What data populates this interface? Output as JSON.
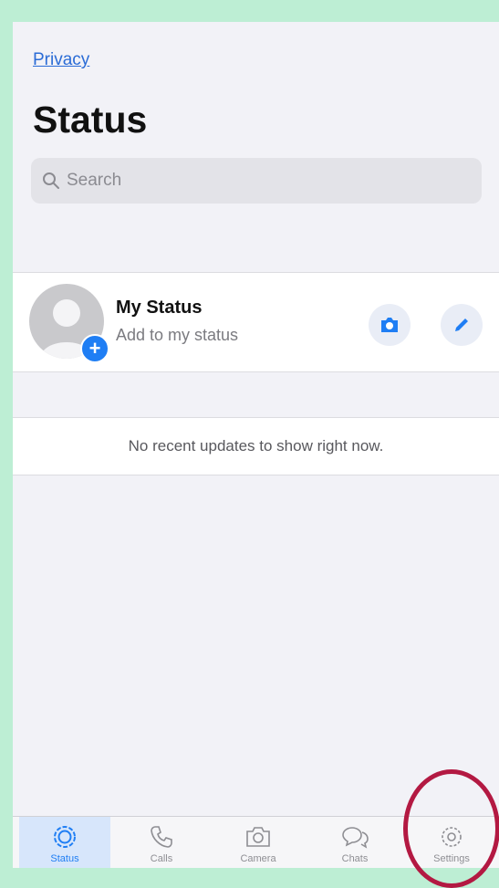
{
  "header": {
    "privacy_link": "Privacy",
    "title": "Status"
  },
  "search": {
    "placeholder": "Search"
  },
  "my_status": {
    "title": "My Status",
    "subtitle": "Add to my status"
  },
  "empty_state": {
    "message": "No recent updates to show right now."
  },
  "tabbar": {
    "tabs": [
      {
        "name": "status",
        "icon": "status-icon",
        "label": "Status",
        "active": true
      },
      {
        "name": "calls",
        "icon": "phone-icon",
        "label": "Calls",
        "active": false
      },
      {
        "name": "camera",
        "icon": "camera-icon",
        "label": "Camera",
        "active": false
      },
      {
        "name": "chats",
        "icon": "chat-bubbles-icon",
        "label": "Chats",
        "active": false
      },
      {
        "name": "settings",
        "icon": "gear-icon",
        "label": "Settings",
        "active": false
      }
    ]
  },
  "colors": {
    "accent": "#1f7ef4",
    "annotation": "#b31942",
    "outer_background": "#bdeed4"
  }
}
